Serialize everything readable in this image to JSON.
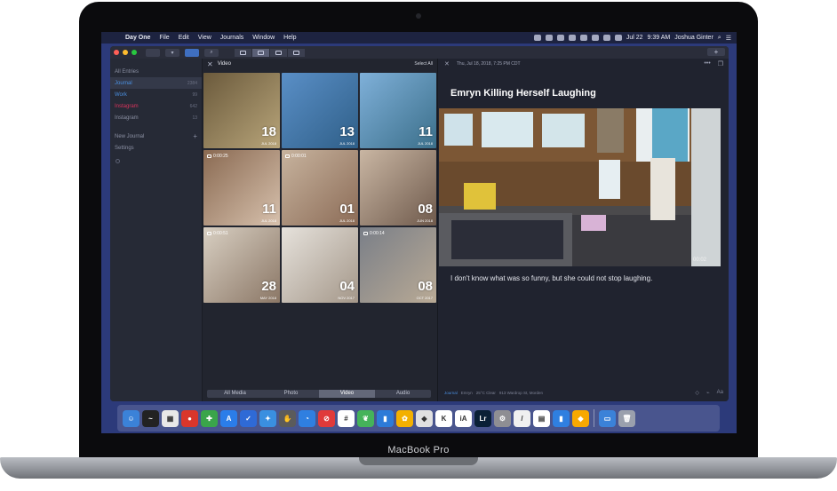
{
  "device": {
    "label": "MacBook Pro"
  },
  "menubar": {
    "app": "Day One",
    "items": [
      "File",
      "Edit",
      "View",
      "Journals",
      "Window",
      "Help"
    ],
    "date": "Jul 22",
    "time": "9:39 AM",
    "user": "Joshua Ginter"
  },
  "sidebar": {
    "items": [
      {
        "label": "All Entries",
        "count": ""
      },
      {
        "label": "Journal",
        "count": "2384"
      },
      {
        "label": "Work",
        "count": "99"
      },
      {
        "label": "Instagram",
        "count": "642"
      },
      {
        "label": "Instagram",
        "count": "13"
      }
    ],
    "new_journal": "New Journal",
    "settings": "Settings"
  },
  "media": {
    "title": "Video",
    "select_all": "Select All",
    "tiles": [
      {
        "day": "18",
        "month": "JUL 2018",
        "duration": "",
        "c1": "#6b5a3c",
        "c2": "#b8a57a"
      },
      {
        "day": "13",
        "month": "JUL 2018",
        "duration": "",
        "c1": "#5a8fc7",
        "c2": "#2f5f88"
      },
      {
        "day": "11",
        "month": "JUL 2018",
        "duration": "",
        "c1": "#7fb0d9",
        "c2": "#3b6f8a"
      },
      {
        "day": "11",
        "month": "JUL 2018",
        "duration": "0:00:25",
        "c1": "#8a6a52",
        "c2": "#d7c1ad"
      },
      {
        "day": "01",
        "month": "JUL 2018",
        "duration": "0:00:01",
        "c1": "#c7b39e",
        "c2": "#8c6c57"
      },
      {
        "day": "08",
        "month": "JUN 2018",
        "duration": "",
        "c1": "#c9b6a3",
        "c2": "#6f5a4c"
      },
      {
        "day": "28",
        "month": "MAY 2018",
        "duration": "0:00:51",
        "c1": "#d8cfc2",
        "c2": "#8b7766"
      },
      {
        "day": "04",
        "month": "NOV 2017",
        "duration": "",
        "c1": "#e6e2dc",
        "c2": "#a49789"
      },
      {
        "day": "08",
        "month": "OCT 2017",
        "duration": "0:00:14",
        "c1": "#7a7f88",
        "c2": "#b9aa95"
      }
    ],
    "tabs": [
      "All Media",
      "Photo",
      "Video",
      "Audio"
    ],
    "active_tab": "Video"
  },
  "entry": {
    "date": "Thu, Jul 18, 2018, 7:25 PM CDT",
    "title": "Emryn Killing Herself Laughing",
    "video_time": "00:02",
    "body": "I don't know what was so funny, but she could not stop laughing.",
    "footer": {
      "journal": "Journal",
      "person": "Emryn",
      "weather": "25°C Clear",
      "location": "913 Wardrop St, Morden"
    }
  },
  "dock": {
    "apps": [
      {
        "name": "finder",
        "color": "#3b82d8",
        "glyph": "☺"
      },
      {
        "name": "activity",
        "color": "#222222",
        "glyph": "~"
      },
      {
        "name": "robot",
        "color": "#e8e8e8",
        "glyph": "▦"
      },
      {
        "name": "record",
        "color": "#d9362b",
        "glyph": "●"
      },
      {
        "name": "maps",
        "color": "#3aa54a",
        "glyph": "✚"
      },
      {
        "name": "appstore",
        "color": "#2b7de9",
        "glyph": "A"
      },
      {
        "name": "tasks",
        "color": "#2f6ad6",
        "glyph": "✓"
      },
      {
        "name": "safari",
        "color": "#3a8fe0",
        "glyph": "✦"
      },
      {
        "name": "hand",
        "color": "#5b5b5b",
        "glyph": "✋"
      },
      {
        "name": "tweetbot",
        "color": "#2f7fe0",
        "glyph": "◔"
      },
      {
        "name": "block",
        "color": "#e03a3a",
        "glyph": "⊘"
      },
      {
        "name": "slack",
        "color": "#ffffff",
        "glyph": "#"
      },
      {
        "name": "evernote",
        "color": "#45b35a",
        "glyph": "❦"
      },
      {
        "name": "bookmarks",
        "color": "#2d7bd8",
        "glyph": "▮"
      },
      {
        "name": "butterfly",
        "color": "#f3b000",
        "glyph": "✿"
      },
      {
        "name": "rooster",
        "color": "#e0e0e0",
        "glyph": "◆"
      },
      {
        "name": "kiwi",
        "color": "#ffffff",
        "glyph": "K"
      },
      {
        "name": "ia",
        "color": "#ffffff",
        "glyph": "iA"
      },
      {
        "name": "lightroom",
        "color": "#0a2036",
        "glyph": "Lr"
      },
      {
        "name": "settings",
        "color": "#8e8e93",
        "glyph": "⚙"
      },
      {
        "name": "notes",
        "color": "#f0f0f0",
        "glyph": "/"
      },
      {
        "name": "pages",
        "color": "#ffffff",
        "glyph": "▤"
      },
      {
        "name": "tab",
        "color": "#2f7fe0",
        "glyph": "▮"
      },
      {
        "name": "sketch",
        "color": "#f7a800",
        "glyph": "◆"
      },
      {
        "name": "downloads",
        "color": "#3b82d8",
        "glyph": "▭"
      },
      {
        "name": "trash",
        "color": "#9aa0ad",
        "glyph": "🗑"
      }
    ]
  }
}
